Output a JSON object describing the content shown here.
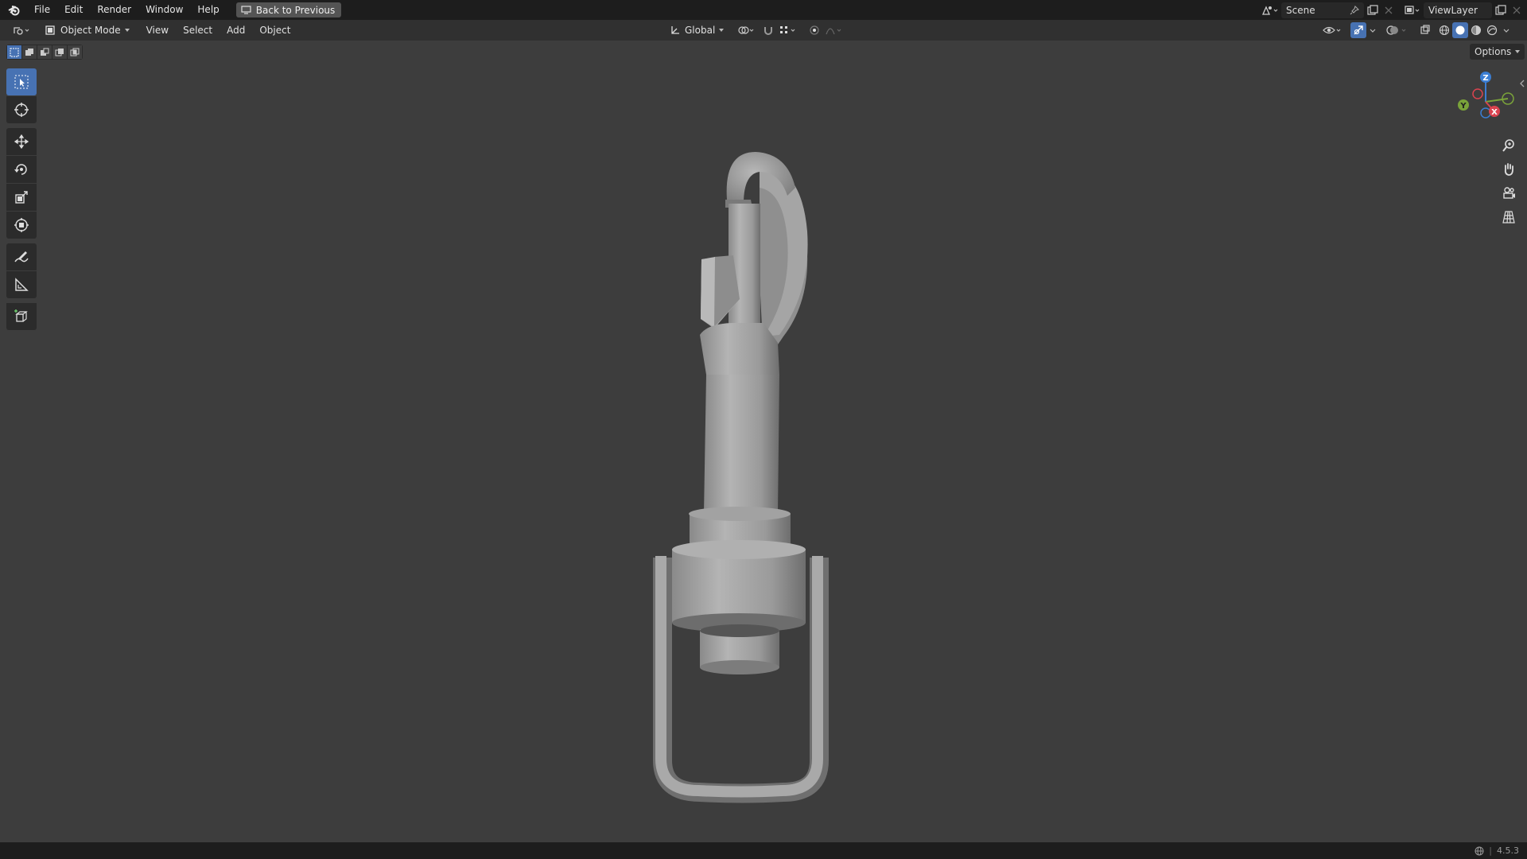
{
  "app": {
    "menu": [
      "File",
      "Edit",
      "Render",
      "Window",
      "Help"
    ],
    "back_button": "Back to Previous",
    "scene": "Scene",
    "view_layer": "ViewLayer"
  },
  "header": {
    "mode": "Object Mode",
    "menus": [
      "View",
      "Select",
      "Add",
      "Object"
    ],
    "transform_orientation": "Global",
    "options": "Options"
  },
  "gizmo": {
    "axes": [
      "Z",
      "Y",
      "X"
    ],
    "colors": {
      "x": "#d9434f",
      "y": "#7aa33a",
      "z": "#3b7ed3"
    }
  },
  "tools": [
    "select-box",
    "cursor",
    "move",
    "rotate",
    "scale",
    "transform",
    "annotate",
    "measure",
    "add-cube"
  ],
  "status": {
    "version": "4.5.3"
  },
  "colors": {
    "accent": "#4772b3",
    "viewport": "#3d3d3d"
  }
}
